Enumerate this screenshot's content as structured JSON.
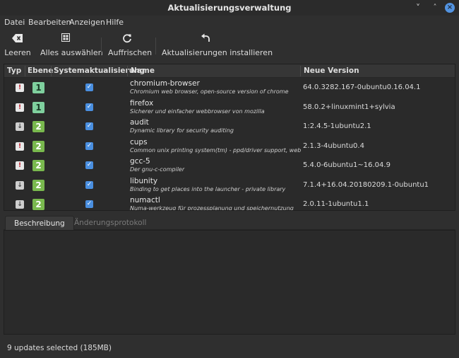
{
  "window": {
    "title": "Aktualisierungsverwaltung",
    "minimize_glyph": "˅",
    "maximize_glyph": "˄",
    "close_glyph": "×"
  },
  "menu": [
    "Datei",
    "Bearbeiten",
    "Anzeigen",
    "Hilfe"
  ],
  "toolbar": {
    "clear": "Leeren",
    "select_all": "Alles auswählen",
    "refresh": "Auffrischen",
    "install": "Aktualisierungen installieren"
  },
  "columns": {
    "type": "Typ",
    "level": "Ebene",
    "system": "Systemaktualisierung",
    "name": "Name",
    "version": "Neue Version"
  },
  "updates": [
    {
      "type": "security",
      "type_glyph": "!",
      "level": "1",
      "checked": "✓",
      "name": "chromium-browser",
      "desc": "Chromium web browser, open-source version of chrome",
      "version": "64.0.3282.167-0ubuntu0.16.04.1"
    },
    {
      "type": "security",
      "type_glyph": "!",
      "level": "1",
      "checked": "✓",
      "name": "firefox",
      "desc": "Sicherer und einfacher webbrowser von mozilla",
      "version": "58.0.2+linuxmint1+sylvia"
    },
    {
      "type": "package",
      "type_glyph": "↓",
      "level": "2",
      "checked": "✓",
      "name": "audit",
      "desc": "Dynamic library for security auditing",
      "version": "1:2.4.5-1ubuntu2.1"
    },
    {
      "type": "security",
      "type_glyph": "!",
      "level": "2",
      "checked": "✓",
      "name": "cups",
      "desc": "Common unix printing system(tm) - ppd/driver support, web interface",
      "version": "2.1.3-4ubuntu0.4"
    },
    {
      "type": "security",
      "type_glyph": "!",
      "level": "2",
      "checked": "✓",
      "name": "gcc-5",
      "desc": "Der gnu-c-compiler",
      "version": "5.4.0-6ubuntu1~16.04.9"
    },
    {
      "type": "package",
      "type_glyph": "↓",
      "level": "2",
      "checked": "✓",
      "name": "libunity",
      "desc": "Binding to get places into the launcher - private library",
      "version": "7.1.4+16.04.20180209.1-0ubuntu1"
    },
    {
      "type": "package",
      "type_glyph": "↓",
      "level": "2",
      "checked": "✓",
      "name": "numactl",
      "desc": "Numa-werkzeug für prozessplanung und speichernutzung",
      "version": "2.0.11-1ubuntu1.1"
    }
  ],
  "tabs": {
    "description": "Beschreibung",
    "changelog": "Änderungsprotokoll"
  },
  "status": "9 updates selected (185MB)",
  "colors": {
    "accent": "#4a8fe0",
    "level1": "#7fd09e",
    "level2": "#79b94e",
    "security": "#c01c28"
  }
}
